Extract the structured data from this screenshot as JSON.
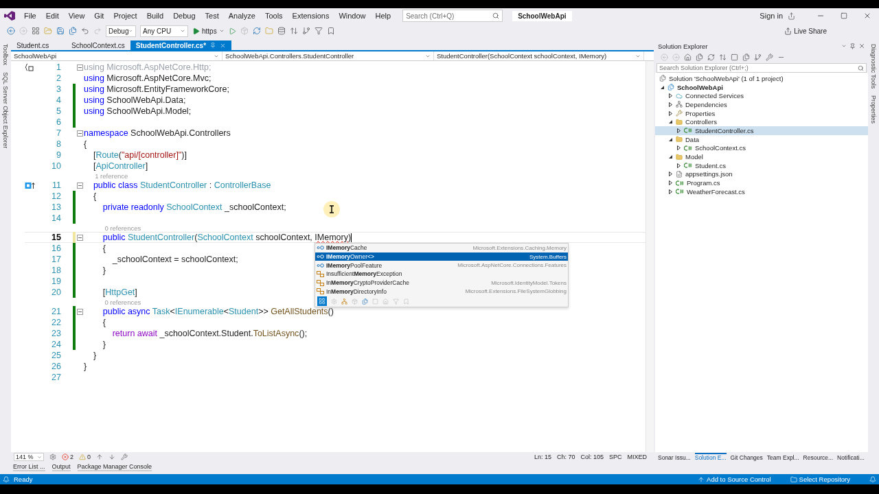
{
  "menu": [
    "File",
    "Edit",
    "View",
    "Git",
    "Project",
    "Build",
    "Debug",
    "Test",
    "Analyze",
    "Tools",
    "Extensions",
    "Window",
    "Help"
  ],
  "search": {
    "placeholder": "Search (Ctrl+Q)"
  },
  "title": "SchoolWebApi",
  "sign_in": "Sign in",
  "toolbar": {
    "configuration": "Debug",
    "platform": "Any CPU",
    "run": "https",
    "live_share": "Live Share"
  },
  "left_strip": [
    "Toolbox",
    "SQL Server Object Explorer"
  ],
  "right_strip": [
    "Diagnostic Tools",
    "Properties"
  ],
  "tabs": [
    {
      "label": "Student.cs",
      "selected": false
    },
    {
      "label": "SchoolContext.cs",
      "selected": false
    },
    {
      "label": "StudentController.cs*",
      "selected": true
    }
  ],
  "nav": [
    "SchoolWebApi",
    "SchoolWebApi.Controllers.StudentController",
    "StudentController(SchoolContext schoolContext, IMemory)"
  ],
  "lines": [
    {
      "number": "1",
      "modified": false,
      "foldable": true,
      "current": false,
      "scope_glyph": true,
      "tokens": [
        {
          "kind": "dim",
          "text": "using Microsoft.AspNetCore.Http;"
        }
      ]
    },
    {
      "number": "2",
      "modified": false,
      "foldable": false,
      "current": false,
      "tokens": [
        {
          "kind": "keyword",
          "text": "using "
        },
        {
          "kind": "plain",
          "text": "Microsoft.AspNetCore.Mvc;"
        }
      ]
    },
    {
      "number": "3",
      "modified": true,
      "saved": true,
      "foldable": false,
      "current": false,
      "tokens": [
        {
          "kind": "keyword",
          "text": "using "
        },
        {
          "kind": "plain",
          "text": "Microsoft.EntityFrameworkCore;"
        }
      ]
    },
    {
      "number": "4",
      "modified": true,
      "saved": true,
      "foldable": false,
      "current": false,
      "tokens": [
        {
          "kind": "keyword",
          "text": "using "
        },
        {
          "kind": "plain",
          "text": "SchoolWebApi.Data;"
        }
      ]
    },
    {
      "number": "5",
      "modified": true,
      "saved": true,
      "foldable": false,
      "current": false,
      "tokens": [
        {
          "kind": "keyword",
          "text": "using "
        },
        {
          "kind": "plain",
          "text": "SchoolWebApi.Model;"
        }
      ]
    },
    {
      "number": "6",
      "modified": true,
      "saved": true,
      "foldable": false,
      "current": false
    },
    {
      "number": "7",
      "modified": false,
      "foldable": true,
      "current": false,
      "tokens": [
        {
          "kind": "keyword",
          "text": "namespace "
        },
        {
          "kind": "plain",
          "text": "SchoolWebApi.Controllers"
        }
      ]
    },
    {
      "number": "8",
      "modified": false,
      "foldable": false,
      "current": false,
      "tokens": [
        {
          "kind": "plain",
          "text": "{"
        }
      ]
    },
    {
      "number": "9",
      "modified": false,
      "foldable": false,
      "current": false,
      "tokens": [
        {
          "kind": "plain",
          "text": "    ["
        },
        {
          "kind": "type",
          "text": "Route"
        },
        {
          "kind": "plain",
          "text": "("
        },
        {
          "kind": "string",
          "text": "\"api/[controller]\""
        },
        {
          "kind": "plain",
          "text": ")]"
        }
      ]
    },
    {
      "number": "10",
      "modified": false,
      "foldable": false,
      "current": false,
      "tokens": [
        {
          "kind": "plain",
          "text": "    ["
        },
        {
          "kind": "type",
          "text": "ApiController"
        },
        {
          "kind": "plain",
          "text": "]"
        }
      ]
    },
    {
      "number": "11",
      "modified": false,
      "foldable": true,
      "current": false,
      "override_glyph": true,
      "lens": "1 reference",
      "tokens": [
        {
          "kind": "keyword",
          "text": "    public class "
        },
        {
          "kind": "type",
          "text": "StudentController"
        },
        {
          "kind": "plain",
          "text": " : "
        },
        {
          "kind": "type",
          "text": "ControllerBase"
        }
      ]
    },
    {
      "number": "12",
      "modified": true,
      "saved": true,
      "foldable": false,
      "current": false,
      "tokens": [
        {
          "kind": "plain",
          "text": "    {"
        }
      ]
    },
    {
      "number": "13",
      "modified": true,
      "saved": true,
      "foldable": false,
      "current": false,
      "tokens": [
        {
          "kind": "keyword",
          "text": "        private readonly "
        },
        {
          "kind": "type",
          "text": "SchoolContext"
        },
        {
          "kind": "plain",
          "text": " _schoolContext;"
        }
      ]
    },
    {
      "number": "14",
      "modified": true,
      "saved": true,
      "foldable": false,
      "current": false
    },
    {
      "number": "15",
      "modified": true,
      "saved": false,
      "foldable": true,
      "current": true,
      "lens": "0 references",
      "tokens": [
        {
          "kind": "keyword",
          "text": "        public "
        },
        {
          "kind": "type",
          "text": "StudentController"
        },
        {
          "kind": "plain",
          "text": "("
        },
        {
          "kind": "type",
          "text": "SchoolContext"
        },
        {
          "kind": "plain",
          "text": " schoolContext, "
        },
        {
          "kind": "error",
          "text": "IMemory"
        },
        {
          "kind": "plain",
          "text": ")"
        }
      ]
    },
    {
      "number": "16",
      "modified": true,
      "saved": true,
      "foldable": false,
      "current": false,
      "tokens": [
        {
          "kind": "plain",
          "text": "        {"
        }
      ]
    },
    {
      "number": "17",
      "modified": true,
      "saved": true,
      "foldable": false,
      "current": false,
      "tokens": [
        {
          "kind": "plain",
          "text": "            _schoolContext = schoolContext;"
        }
      ]
    },
    {
      "number": "18",
      "modified": true,
      "saved": true,
      "foldable": false,
      "current": false,
      "tokens": [
        {
          "kind": "plain",
          "text": "        }"
        }
      ]
    },
    {
      "number": "19",
      "modified": true,
      "saved": true,
      "foldable": false,
      "current": false
    },
    {
      "number": "20",
      "modified": true,
      "saved": true,
      "foldable": false,
      "current": false,
      "tokens": [
        {
          "kind": "plain",
          "text": "        ["
        },
        {
          "kind": "type",
          "text": "HttpGet"
        },
        {
          "kind": "plain",
          "text": "]"
        }
      ]
    },
    {
      "number": "21",
      "modified": true,
      "saved": true,
      "foldable": true,
      "current": false,
      "lens": "0 references",
      "tokens": [
        {
          "kind": "keyword",
          "text": "        public async "
        },
        {
          "kind": "type",
          "text": "Task"
        },
        {
          "kind": "plain",
          "text": "<"
        },
        {
          "kind": "type",
          "text": "IEnumerable"
        },
        {
          "kind": "plain",
          "text": "<"
        },
        {
          "kind": "type",
          "text": "Student"
        },
        {
          "kind": "plain",
          "text": ">> "
        },
        {
          "kind": "method",
          "text": "GetAllStudents"
        },
        {
          "kind": "plain",
          "text": "()"
        }
      ]
    },
    {
      "number": "22",
      "modified": true,
      "saved": true,
      "foldable": false,
      "current": false,
      "tokens": [
        {
          "kind": "plain",
          "text": "        {"
        }
      ]
    },
    {
      "number": "23",
      "modified": true,
      "saved": true,
      "foldable": false,
      "current": false,
      "tokens": [
        {
          "kind": "control",
          "text": "            return await"
        },
        {
          "kind": "plain",
          "text": " _schoolContext.Student."
        },
        {
          "kind": "method",
          "text": "ToListAsync"
        },
        {
          "kind": "plain",
          "text": "();"
        }
      ]
    },
    {
      "number": "24",
      "modified": true,
      "saved": true,
      "foldable": false,
      "current": false,
      "tokens": [
        {
          "kind": "plain",
          "text": "        }"
        }
      ]
    },
    {
      "number": "25",
      "modified": false,
      "foldable": false,
      "current": false,
      "tokens": [
        {
          "kind": "plain",
          "text": "    }"
        }
      ]
    },
    {
      "number": "26",
      "modified": false,
      "foldable": false,
      "current": false,
      "tokens": [
        {
          "kind": "plain",
          "text": "}"
        }
      ]
    },
    {
      "number": "27",
      "modified": false,
      "foldable": false,
      "current": false
    }
  ],
  "completions": [
    {
      "kind": "interface",
      "label": "**IMemory**Cache",
      "namespace": "Microsoft.Extensions.Caching.Memory",
      "selected": false
    },
    {
      "kind": "interface",
      "label": "**IMemory**Owner<>",
      "namespace": "System.Buffers",
      "selected": true
    },
    {
      "kind": "interface",
      "label": "**IMemory**PoolFeature",
      "namespace": "Microsoft.AspNetCore.Connections.Features",
      "selected": false
    },
    {
      "kind": "class",
      "label": "Insufficient**Memory**Exception",
      "selected": false
    },
    {
      "kind": "class",
      "label": "In**Memory**CryptoProviderCache",
      "namespace": "Microsoft.IdentityModel.Tokens",
      "selected": false
    },
    {
      "kind": "class",
      "label": "In**Memory**DirectoryInfo",
      "namespace": "Microsoft.Extensions.FileSystemGlobbing",
      "selected": false
    }
  ],
  "editor_status": {
    "zoom": "141 %",
    "errors": "2",
    "warnings": "0",
    "line": "Ln: 15",
    "char": "Ch: 70",
    "column": "Col: 105",
    "whitespace": "SPC",
    "line_endings": "MIXED"
  },
  "solution_explorer": {
    "title": "Solution Explorer",
    "search_placeholder": "Search Solution Explorer (Ctrl+;)",
    "solution": "Solution 'SchoolWebApi' (1 of 1 project)",
    "tree": [
      {
        "label": "SchoolWebApi",
        "kind": "project",
        "expanded": true,
        "selected": false,
        "children": [
          {
            "label": "Connected Services",
            "kind": "services",
            "expanded": false,
            "selected": false
          },
          {
            "label": "Dependencies",
            "kind": "dependencies",
            "expanded": false,
            "selected": false
          },
          {
            "label": "Properties",
            "kind": "properties",
            "expanded": false,
            "selected": false
          },
          {
            "label": "Controllers",
            "kind": "folder",
            "expanded": true,
            "selected": false,
            "children": [
              {
                "label": "StudentController.cs",
                "kind": "csharp",
                "expanded": false,
                "selected": true
              }
            ]
          },
          {
            "label": "Data",
            "kind": "folder",
            "expanded": true,
            "selected": false,
            "children": [
              {
                "label": "SchoolContext.cs",
                "kind": "csharp",
                "expanded": false,
                "selected": false
              }
            ]
          },
          {
            "label": "Model",
            "kind": "folder",
            "expanded": true,
            "selected": false,
            "children": [
              {
                "label": "Student.cs",
                "kind": "csharp",
                "expanded": false,
                "selected": false
              }
            ]
          },
          {
            "label": "appsettings.json",
            "kind": "json",
            "expanded": false,
            "selected": false
          },
          {
            "label": "Program.cs",
            "kind": "csharp",
            "expanded": false,
            "selected": false
          },
          {
            "label": "WeatherForecast.cs",
            "kind": "csharp",
            "expanded": false,
            "selected": false
          }
        ]
      }
    ]
  },
  "panel_tabs": [
    {
      "label": "Sonar Issu...",
      "selected": false
    },
    {
      "label": "Solution E...",
      "selected": true
    },
    {
      "label": "Git Changes",
      "selected": false
    },
    {
      "label": "Team Expl...",
      "selected": false
    },
    {
      "label": "Resource...",
      "selected": false
    },
    {
      "label": "Notificati...",
      "selected": false
    }
  ],
  "bottom_tabs": [
    "Error List ...",
    "Output",
    "Package Manager Console"
  ],
  "status_bar": {
    "state": "Ready",
    "source_control": "Add to Source Control",
    "repository": "Select Repository"
  }
}
